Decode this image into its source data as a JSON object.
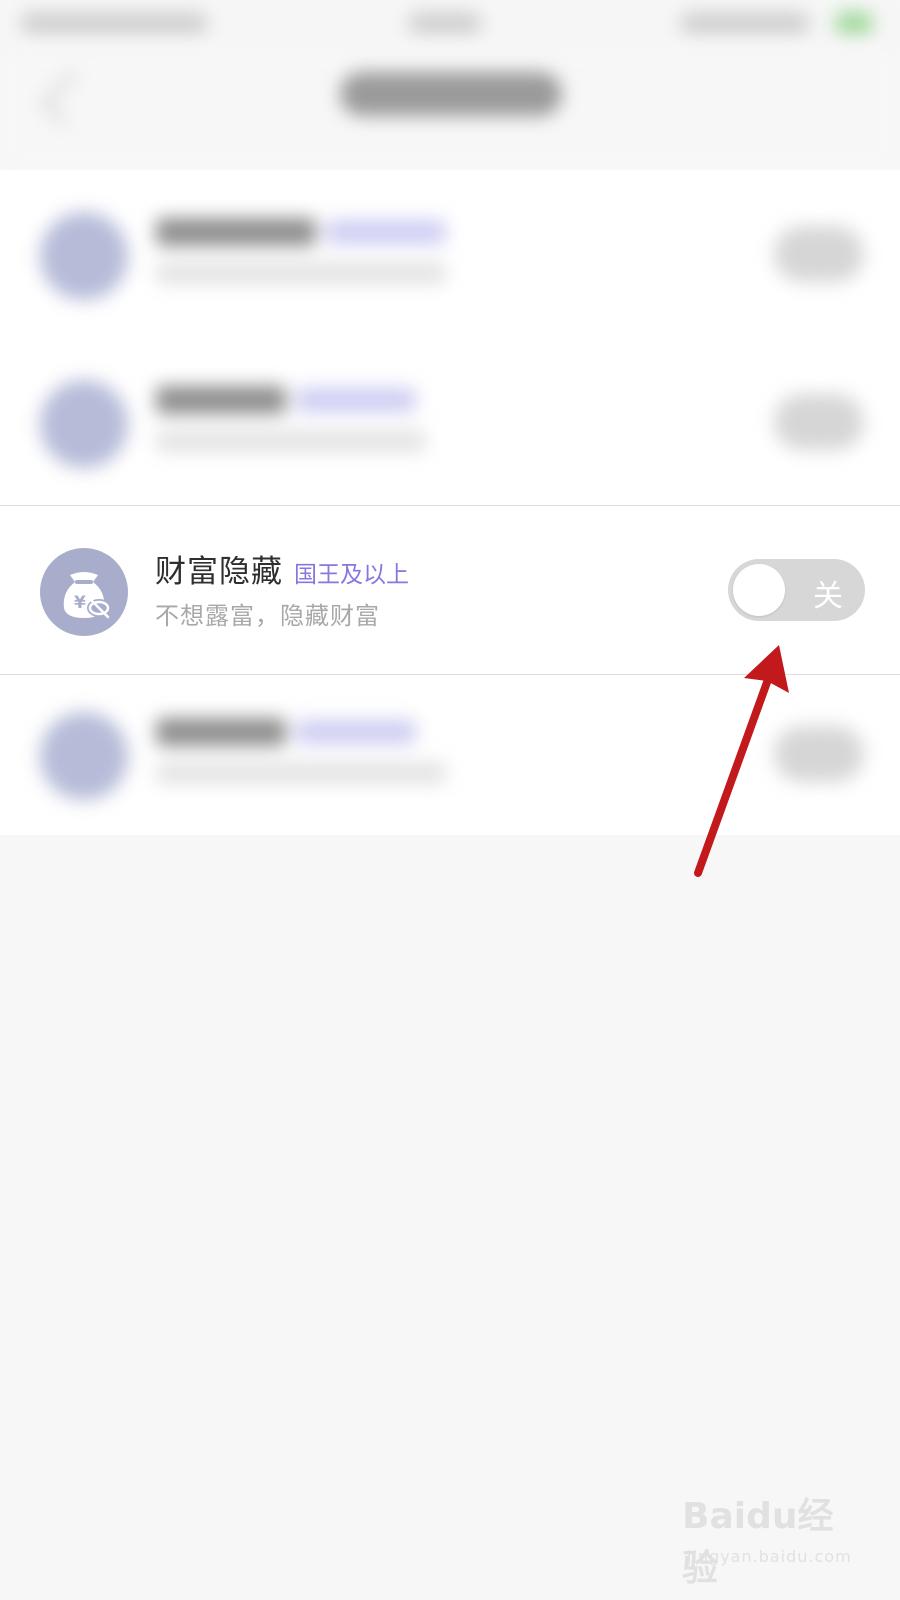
{
  "setting": {
    "title": "财富隐藏",
    "tag": "国王及以上",
    "subtitle": "不想露富，隐藏财富",
    "toggle_label": "关",
    "toggle_on": false
  },
  "icons": {
    "feature_icon": "money-bag-hidden-icon"
  },
  "colors": {
    "tag": "#8678df",
    "icon_bg": "#a8adcc",
    "annotation_arrow": "#c2191c"
  },
  "watermark": {
    "logo": "Baidu经验",
    "url": "jingyan.baidu.com"
  }
}
